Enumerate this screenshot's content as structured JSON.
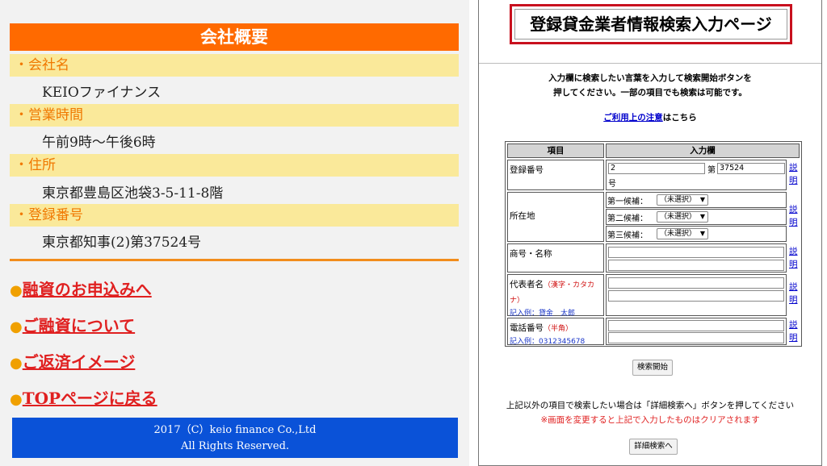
{
  "left": {
    "title": "会社概要",
    "rows": [
      {
        "label": "・会社名",
        "value": "KEIOファイナンス"
      },
      {
        "label": "・営業時間",
        "value": "午前9時〜午後6時"
      },
      {
        "label": "・住所",
        "value": "東京都豊島区池袋3-5-11-8階"
      },
      {
        "label": "・登録番号",
        "value": "東京都知事(2)第37524号"
      }
    ],
    "links": [
      {
        "bullet": "●",
        "text": "融資のお申込みへ"
      },
      {
        "bullet": "●",
        "text": "ご融資について"
      },
      {
        "bullet": "●",
        "text": "ご返済イメージ"
      },
      {
        "bullet": "●",
        "text": "TOPページに戻る"
      }
    ],
    "footer_line1": "2017（C）keio finance Co.,Ltd",
    "footer_line2": "All Rights Reserved."
  },
  "right": {
    "title": "登録貸金業者情報検索入力ページ",
    "instructions_line1": "入力欄に検索したい言葉を入力して検索開始ボタンを",
    "instructions_line2": "押してください。一部の項目でも検索は可能です。",
    "notice_link": "ご利用上の注意",
    "notice_suffix": "はこちら",
    "table": {
      "header_item": "項目",
      "header_input": "入力欄",
      "reg_label": "登録番号",
      "reg_value1": "2",
      "reg_dai": "第",
      "reg_value2": "37524",
      "reg_go": "号",
      "addr_label": "所在地",
      "addr_choices": [
        {
          "label": "第一候補：",
          "value": "（未選択）"
        },
        {
          "label": "第二候補：",
          "value": "（未選択）"
        },
        {
          "label": "第三候補：",
          "value": "（未選択）"
        }
      ],
      "trade_label": "商号・名称",
      "rep_label": "代表者名",
      "rep_hint": "（漢字・カタカナ）",
      "rep_example": "記入例：貸金　太郎",
      "phone_label": "電話番号",
      "phone_hint": "（半角）",
      "phone_example": "記入例：0312345678",
      "explain": "説明"
    },
    "search_button": "検索開始",
    "bottom_note": "上記以外の項目で検索したい場合は「詳細検索へ」ボタンを押してください",
    "bottom_warning": "※画面を変更すると上記で入力したものはクリアされます",
    "detail_button": "詳細検索へ"
  }
}
